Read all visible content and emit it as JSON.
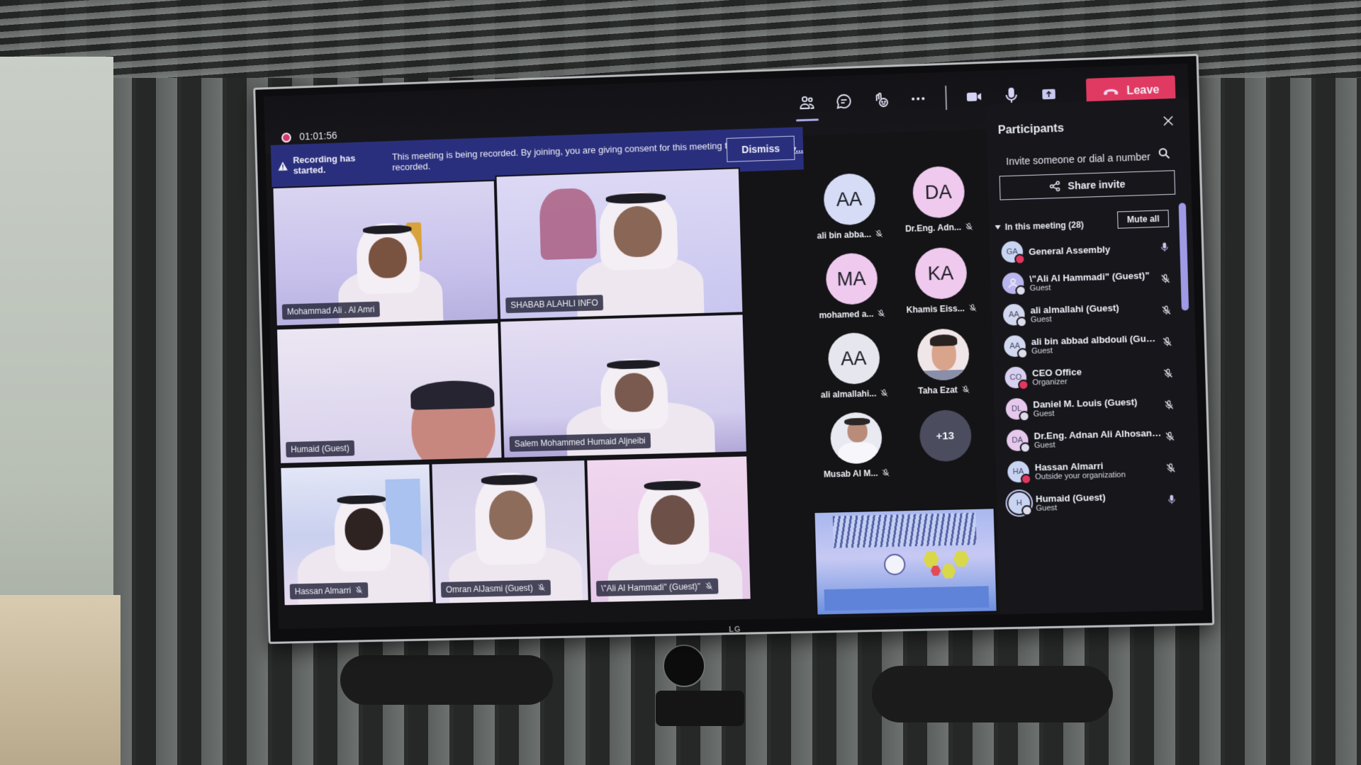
{
  "meeting": {
    "elapsed_time": "01:01:56",
    "recording": true
  },
  "toolbar": {
    "buttons": [
      {
        "name": "people",
        "icon": "people-icon",
        "active": true
      },
      {
        "name": "chat",
        "icon": "chat-icon",
        "active": false
      },
      {
        "name": "reactions",
        "icon": "reactions-icon",
        "active": false
      },
      {
        "name": "more",
        "icon": "more-icon",
        "active": false
      }
    ],
    "device_buttons": [
      {
        "name": "camera",
        "icon": "camera-icon"
      },
      {
        "name": "mic",
        "icon": "mic-icon"
      },
      {
        "name": "share",
        "icon": "share-screen-icon"
      }
    ],
    "leave_label": "Leave"
  },
  "banner": {
    "title": "Recording has started.",
    "message": "This meeting is being recorded. By joining, you are giving consent for this meeting to be recorded.",
    "link": "Priv...",
    "dismiss_label": "Dismiss"
  },
  "video_tiles": [
    {
      "name": "Mohammad Ali . Al Amri",
      "muted": false
    },
    {
      "name": "SHABAB ALAHLI INFO",
      "muted": false
    },
    {
      "name": "Humaid (Guest)",
      "muted": false
    },
    {
      "name": "Salem Mohammed Humaid Aljneibi",
      "muted": false
    },
    {
      "name": "Hassan Almarri",
      "muted": true
    },
    {
      "name": "Omran AlJasmi (Guest)",
      "muted": true
    },
    {
      "name": "\\\"Ali Al Hammadi\" (Guest)\"",
      "muted": true
    }
  ],
  "avatar_tiles": [
    {
      "initials": "AA",
      "name": "ali bin abba...",
      "muted": true,
      "color": "#d6dcf6"
    },
    {
      "initials": "DA",
      "name": "Dr.Eng. Adn...",
      "muted": true,
      "color": "#efc9ee"
    },
    {
      "initials": "MA",
      "name": "mohamed a...",
      "muted": true,
      "color": "#efc9ee"
    },
    {
      "initials": "KA",
      "name": "Khamis Eiss...",
      "muted": true,
      "color": "#efc9ee"
    },
    {
      "initials": "AA",
      "name": "ali almallahi...",
      "muted": true,
      "color": "#e6e6ee"
    },
    {
      "initials": "",
      "name": "Taha Ezat",
      "muted": true,
      "color": "#f0e6e8",
      "photo": true
    },
    {
      "initials": "",
      "name": "Musab Al M...",
      "muted": true,
      "color": "#e9e9f2",
      "photo": true
    },
    {
      "initials": "+13",
      "name": "",
      "muted": false,
      "color": "#4b4c5e",
      "overflow": true
    }
  ],
  "participants_panel": {
    "title": "Participants",
    "invite_placeholder": "Invite someone or dial a number",
    "share_invite_label": "Share invite",
    "section_label": "In this meeting (28)",
    "mute_all_label": "Mute all",
    "participants": [
      {
        "initials": "GA",
        "name": "General Assembly",
        "role": "",
        "status": "busy",
        "mic": "on",
        "color": "#c9d4f2"
      },
      {
        "initials": "",
        "name": "\\\"Ali Al Hammadi\" (Guest)\"",
        "role": "Guest",
        "status": "guest",
        "mic": "off",
        "color": "#b9b6ee",
        "placeholder_avatar": true
      },
      {
        "initials": "AA",
        "name": "ali almallahi (Guest)",
        "role": "Guest",
        "status": "guest",
        "mic": "off",
        "color": "#d2d8f0"
      },
      {
        "initials": "AA",
        "name": "ali bin abbad albdouli (Guest)",
        "role": "Guest",
        "status": "guest",
        "mic": "off",
        "color": "#d2d8f0"
      },
      {
        "initials": "CO",
        "name": "CEO Office",
        "role": "Organizer",
        "status": "busy",
        "mic": "off",
        "color": "#d8d0f0"
      },
      {
        "initials": "DL",
        "name": "Daniel M. Louis (Guest)",
        "role": "Guest",
        "status": "guest",
        "mic": "off",
        "color": "#e6c8ec"
      },
      {
        "initials": "DA",
        "name": "Dr.Eng. Adnan Ali Alhosani (G...",
        "role": "Guest",
        "status": "guest",
        "mic": "off",
        "color": "#e6c8ec"
      },
      {
        "initials": "HA",
        "name": "Hassan Almarri",
        "role": "Outside your organization",
        "status": "busy",
        "mic": "off",
        "color": "#c9d4f2"
      },
      {
        "initials": "H",
        "name": "Humaid (Guest)",
        "role": "Guest",
        "status": "guest",
        "mic": "on",
        "color": "#c9d4f2",
        "speaking": true
      }
    ]
  },
  "device": {
    "brand": "LG"
  },
  "colors": {
    "accent": "#a6a3ec",
    "leave": "#e03a62",
    "banner": "#2a2f7d",
    "busy": "#e0385f",
    "panel_bg": "#17171b"
  }
}
